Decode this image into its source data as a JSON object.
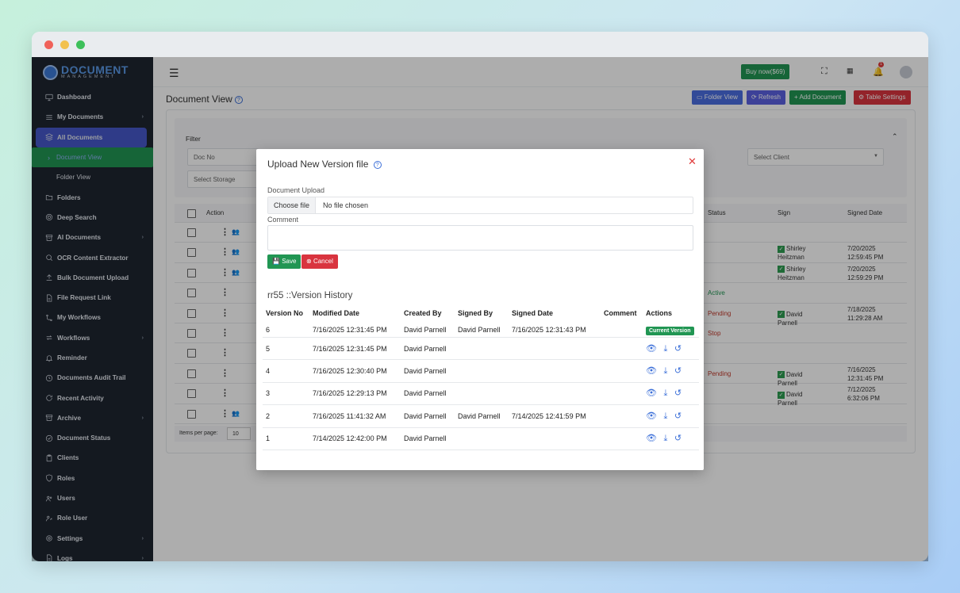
{
  "window": {
    "controls": [
      "close",
      "minimize",
      "maximize"
    ]
  },
  "brand": {
    "name": "DOCUMENT",
    "sub": "MANAGEMENT"
  },
  "sidebar": {
    "items": [
      {
        "label": "Dashboard",
        "icon": "monitor-icon",
        "chev": false
      },
      {
        "label": "My Documents",
        "icon": "list-icon",
        "chev": true
      },
      {
        "label": "All Documents",
        "icon": "layers-icon",
        "chev": false,
        "active": true
      },
      {
        "label": "Document View",
        "sub": true,
        "current": true
      },
      {
        "label": "Folder View",
        "sub": true
      },
      {
        "label": "Folders",
        "icon": "folder-icon",
        "chev": false
      },
      {
        "label": "Deep Search",
        "icon": "target-icon",
        "chev": false
      },
      {
        "label": "AI Documents",
        "icon": "archive-icon",
        "chev": true
      },
      {
        "label": "OCR Content Extractor",
        "icon": "search-icon",
        "chev": false
      },
      {
        "label": "Bulk Document Upload",
        "icon": "upload-icon",
        "chev": false
      },
      {
        "label": "File Request Link",
        "icon": "file-icon",
        "chev": false
      },
      {
        "label": "My Workflows",
        "icon": "workflow-icon",
        "chev": false
      },
      {
        "label": "Workflows",
        "icon": "repeat-icon",
        "chev": true
      },
      {
        "label": "Reminder",
        "icon": "bell-icon",
        "chev": false
      },
      {
        "label": "Documents Audit Trail",
        "icon": "clock-icon",
        "chev": false
      },
      {
        "label": "Recent Activity",
        "icon": "refresh-icon",
        "chev": false
      },
      {
        "label": "Archive",
        "icon": "archive-icon",
        "chev": true
      },
      {
        "label": "Document Status",
        "icon": "check-circle-icon",
        "chev": false
      },
      {
        "label": "Clients",
        "icon": "clipboard-icon",
        "chev": false
      },
      {
        "label": "Roles",
        "icon": "shield-icon",
        "chev": false
      },
      {
        "label": "Users",
        "icon": "users-icon",
        "chev": false
      },
      {
        "label": "Role User",
        "icon": "user-key-icon",
        "chev": false
      },
      {
        "label": "Settings",
        "icon": "gear-icon",
        "chev": true
      },
      {
        "label": "Logs",
        "icon": "file-icon",
        "chev": true
      }
    ]
  },
  "topbar": {
    "buy_label": "Buy now($69)",
    "notification_count": "1"
  },
  "page": {
    "title": "Document View",
    "buttons": {
      "folder_view": "Folder View",
      "refresh": "Refresh",
      "add_document": "+ Add Document",
      "table_settings": "Table Settings"
    }
  },
  "filter": {
    "title": "Filter",
    "doc_no_placeholder": "Doc No",
    "select_client": "Select Client",
    "select_storage": "Select Storage"
  },
  "docs_table": {
    "headers": {
      "action": "Action",
      "status": "Status",
      "sign": "Sign",
      "signed_date": "Signed Date"
    },
    "rows": [
      {
        "group": true,
        "status": "",
        "sign": "",
        "date": ""
      },
      {
        "group": true,
        "status": "",
        "sign": "Shirley Heitzman",
        "date": "7/20/2025 12:59:45 PM"
      },
      {
        "group": true,
        "status": "",
        "sign": "Shirley Heitzman",
        "date": "7/20/2025 12:59:29 PM"
      },
      {
        "group": false,
        "status": "Active",
        "sign": "",
        "date": ""
      },
      {
        "group": false,
        "status": "Pending",
        "sign": "David Parnell",
        "date": "7/18/2025 11:29:28 AM"
      },
      {
        "group": false,
        "status": "Stop",
        "sign": "",
        "date": ""
      },
      {
        "group": false,
        "status": "",
        "sign": "",
        "date": ""
      },
      {
        "group": false,
        "status": "Pending",
        "sign": "David Parnell",
        "date": "7/16/2025 12:31:45 PM"
      },
      {
        "group": false,
        "status": "",
        "sign": "David Parnell",
        "date": "7/12/2025 6:32:06 PM"
      },
      {
        "group": true,
        "status": "",
        "sign": "",
        "date": ""
      }
    ],
    "items_per_page_label": "Items per page:",
    "items_per_page_value": "10"
  },
  "modal": {
    "title": "Upload New Version file",
    "upload_label": "Document Upload",
    "choose_file": "Choose file",
    "no_file": "No file chosen",
    "comment_label": "Comment",
    "save_label": "Save",
    "cancel_label": "Cancel",
    "history_title": "rr55 ::Version History",
    "headers": [
      "Version No",
      "Modified Date",
      "Created By",
      "Signed By",
      "Signed Date",
      "Comment",
      "Actions"
    ],
    "current_version_label": "Current Version",
    "versions": [
      {
        "no": "6",
        "modified": "7/16/2025 12:31:45 PM",
        "created_by": "David Parnell",
        "signed_by": "David Parnell",
        "signed_date": "7/16/2025 12:31:43 PM",
        "comment": "",
        "current": true
      },
      {
        "no": "5",
        "modified": "7/16/2025 12:31:45 PM",
        "created_by": "David Parnell",
        "signed_by": "",
        "signed_date": "",
        "comment": "",
        "current": false
      },
      {
        "no": "4",
        "modified": "7/16/2025 12:30:40 PM",
        "created_by": "David Parnell",
        "signed_by": "",
        "signed_date": "",
        "comment": "",
        "current": false
      },
      {
        "no": "3",
        "modified": "7/16/2025 12:29:13 PM",
        "created_by": "David Parnell",
        "signed_by": "",
        "signed_date": "",
        "comment": "",
        "current": false
      },
      {
        "no": "2",
        "modified": "7/16/2025 11:41:32 AM",
        "created_by": "David Parnell",
        "signed_by": "David Parnell",
        "signed_date": "7/14/2025 12:41:59 PM",
        "comment": "",
        "current": false
      },
      {
        "no": "1",
        "modified": "7/14/2025 12:42:00 PM",
        "created_by": "David Parnell",
        "signed_by": "",
        "signed_date": "",
        "comment": "",
        "current": false
      }
    ]
  },
  "colors": {
    "sidebar_bg": "#1e2530",
    "active_nav": "#4657c9",
    "success": "#219653",
    "danger": "#d9343f",
    "primary": "#3b6fd8"
  }
}
